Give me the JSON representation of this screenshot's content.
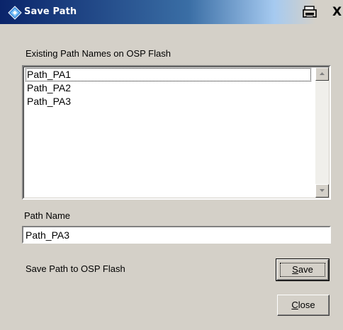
{
  "window": {
    "title": "Save Path",
    "icons": {
      "app": "blue-diamond-app-icon",
      "print": "printer-icon",
      "close": "close-icon"
    },
    "close_glyph": "X"
  },
  "existing_paths": {
    "label": "Existing Path Names on OSP Flash",
    "items": [
      {
        "label": "Path_PA1",
        "focused": true
      },
      {
        "label": "Path_PA2",
        "focused": false
      },
      {
        "label": "Path_PA3",
        "focused": false
      }
    ]
  },
  "path_name": {
    "label": "Path Name",
    "value": "Path_PA3"
  },
  "save_section": {
    "label": "Save Path to OSP Flash"
  },
  "buttons": {
    "save": {
      "mnemonic": "S",
      "rest": "ave"
    },
    "close": {
      "mnemonic": "C",
      "rest": "lose"
    }
  },
  "colors": {
    "titlebar_start": "#0a246a",
    "titlebar_end": "#a6caf0",
    "face": "#d4d0c8"
  }
}
